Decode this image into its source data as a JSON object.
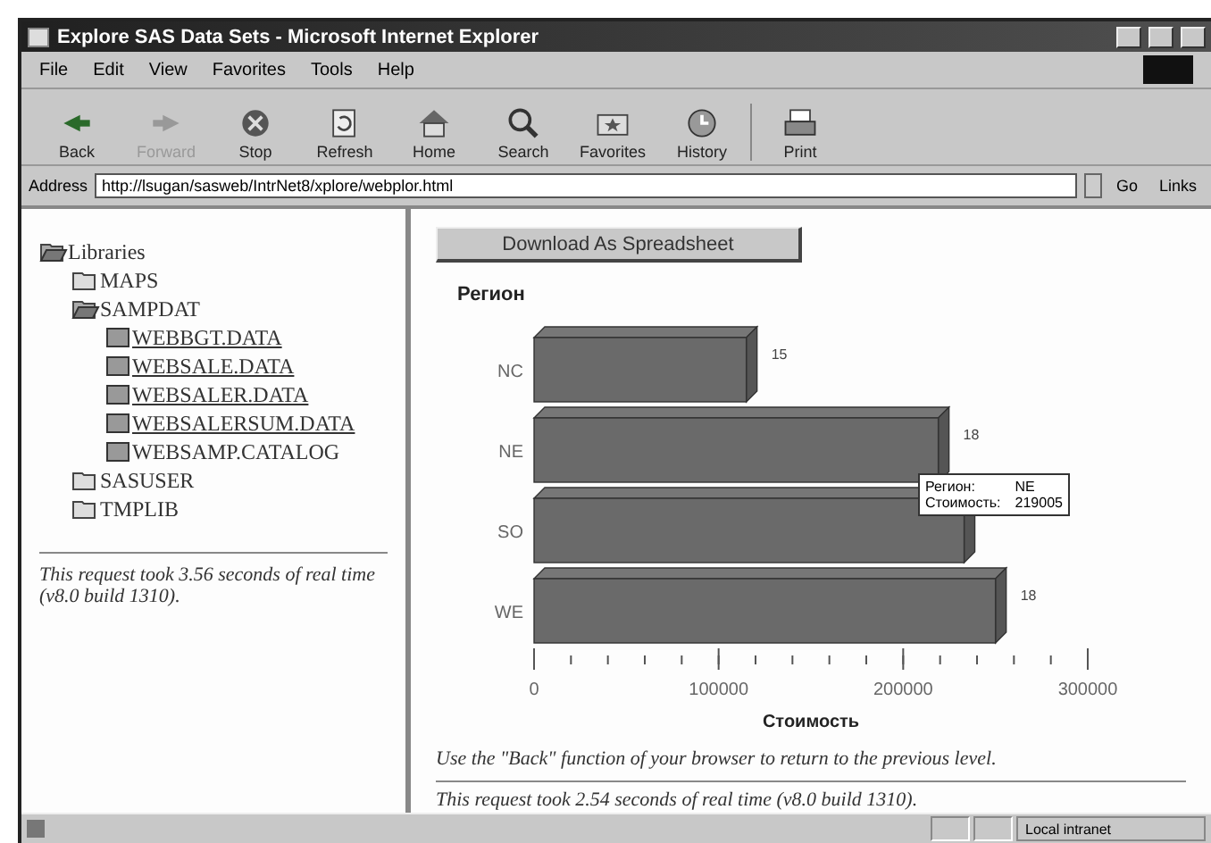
{
  "window": {
    "title": "Explore SAS Data Sets - Microsoft Internet Explorer"
  },
  "menu": [
    "File",
    "Edit",
    "View",
    "Favorites",
    "Tools",
    "Help"
  ],
  "toolbar": [
    {
      "label": "Back",
      "kind": "back",
      "disabled": false
    },
    {
      "label": "Forward",
      "kind": "forward",
      "disabled": true
    },
    {
      "label": "Stop",
      "kind": "stop",
      "disabled": false
    },
    {
      "label": "Refresh",
      "kind": "refresh",
      "disabled": false
    },
    {
      "label": "Home",
      "kind": "home",
      "disabled": false
    },
    {
      "label": "Search",
      "kind": "search",
      "disabled": false
    },
    {
      "label": "Favorites",
      "kind": "favorites",
      "disabled": false
    },
    {
      "label": "History",
      "kind": "history",
      "disabled": false
    },
    {
      "label": "Print",
      "kind": "print",
      "disabled": false
    }
  ],
  "address": {
    "label": "Address",
    "value": "http://lsugan/sasweb/IntrNet8/xplore/webplor.html",
    "go": "Go",
    "links": "Links"
  },
  "tree": [
    {
      "label": "Libraries",
      "expanded": true,
      "linked": false,
      "children": [
        {
          "label": "MAPS",
          "expanded": false,
          "linked": false
        },
        {
          "label": "SAMPDAT",
          "expanded": true,
          "linked": false,
          "children": [
            {
              "label": "WEBBGT.DATA",
              "linked": true
            },
            {
              "label": "WEBSALE.DATA",
              "linked": true
            },
            {
              "label": "WEBSALER.DATA",
              "linked": true
            },
            {
              "label": "WEBSALERSUM.DATA",
              "linked": true
            },
            {
              "label": "WEBSAMP.CATALOG",
              "linked": false
            }
          ]
        },
        {
          "label": "SASUSER",
          "expanded": false,
          "linked": false
        },
        {
          "label": "TMPLIB",
          "expanded": false,
          "linked": false
        }
      ]
    }
  ],
  "left_note": "This request took 3.56 seconds of real time (v8.0 build 1310).",
  "download_button": "Download As Spreadsheet",
  "chart": {
    "chart_data": {
      "type": "bar",
      "orientation": "horizontal",
      "ylabel": "Регион",
      "xlabel": "Стоимость",
      "categories": [
        "NC",
        "NE",
        "SO",
        "WE"
      ],
      "values": [
        115000,
        219005,
        233000,
        250000
      ],
      "xlim": [
        0,
        300000
      ],
      "xticks": [
        0,
        100000,
        200000,
        300000
      ],
      "annotations": [
        {
          "x": 115000,
          "y": "NC",
          "text": "15"
        },
        {
          "x": 219005,
          "y": "NE",
          "text": "18"
        },
        {
          "x": 250000,
          "y": "WE",
          "text": "18"
        }
      ]
    },
    "tooltip": [
      {
        "key": "Регион:",
        "value": "NE"
      },
      {
        "key": "Стоимость:",
        "value": "219005"
      }
    ]
  },
  "back_note": "Use the \"Back\" function of your browser to return to the previous level.",
  "right_note": "This request took 2.54 seconds of real time (v8.0 build 1310).",
  "status_bar": {
    "zone": "Local intranet"
  }
}
